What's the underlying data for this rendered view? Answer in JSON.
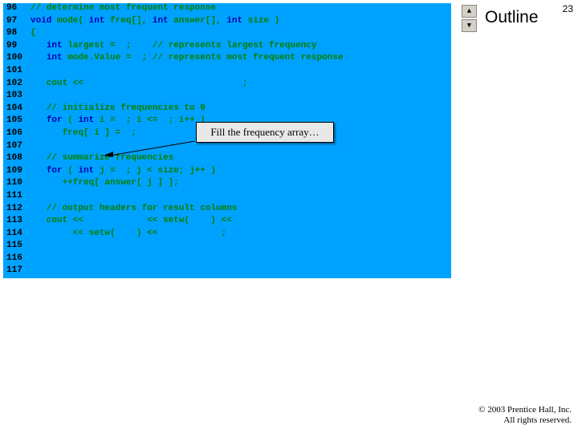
{
  "slide_number": "23",
  "outline_label": "Outline",
  "annotation": "Fill the frequency array…",
  "copyright_line1": "© 2003 Prentice Hall, Inc.",
  "copyright_line2": "All rights reserved.",
  "lines": [
    {
      "n": "96",
      "tokens": [
        {
          "t": "// determine most frequent response",
          "c": "cm"
        }
      ]
    },
    {
      "n": "97",
      "tokens": [
        {
          "t": "void",
          "c": "kw"
        },
        {
          "t": " mode( "
        },
        {
          "t": "int",
          "c": "kw"
        },
        {
          "t": " freq[], "
        },
        {
          "t": "int",
          "c": "kw"
        },
        {
          "t": " answer[], "
        },
        {
          "t": "int",
          "c": "kw"
        },
        {
          "t": " size )"
        }
      ]
    },
    {
      "n": "98",
      "tokens": [
        {
          "t": "{"
        }
      ]
    },
    {
      "n": "99",
      "tokens": [
        {
          "t": "   "
        },
        {
          "t": "int",
          "c": "kw"
        },
        {
          "t": " largest =  ;    "
        },
        {
          "t": "// represents largest frequency",
          "c": "cm"
        }
      ]
    },
    {
      "n": "100",
      "tokens": [
        {
          "t": "   "
        },
        {
          "t": "int",
          "c": "kw"
        },
        {
          "t": " mode.Value =  ; "
        },
        {
          "t": "// represents most frequent response",
          "c": "cm"
        }
      ]
    },
    {
      "n": "101",
      "tokens": []
    },
    {
      "n": "102",
      "tokens": [
        {
          "t": "   cout <<                              ;"
        }
      ]
    },
    {
      "n": "103",
      "tokens": []
    },
    {
      "n": "104",
      "tokens": [
        {
          "t": "   "
        },
        {
          "t": "// initialize frequencies to 0",
          "c": "cm"
        }
      ]
    },
    {
      "n": "105",
      "tokens": [
        {
          "t": "   "
        },
        {
          "t": "for",
          "c": "kw"
        },
        {
          "t": " ( "
        },
        {
          "t": "int",
          "c": "kw"
        },
        {
          "t": " i =  ; i <=  ; i++ )"
        }
      ]
    },
    {
      "n": "106",
      "tokens": [
        {
          "t": "      freq[ i ] =  ;"
        }
      ]
    },
    {
      "n": "107",
      "tokens": []
    },
    {
      "n": "108",
      "tokens": [
        {
          "t": "   "
        },
        {
          "t": "// summarize frequencies",
          "c": "cm"
        }
      ]
    },
    {
      "n": "109",
      "tokens": [
        {
          "t": "   "
        },
        {
          "t": "for",
          "c": "kw"
        },
        {
          "t": " ( "
        },
        {
          "t": "int",
          "c": "kw"
        },
        {
          "t": " j =  ; j < size; j++ )"
        }
      ]
    },
    {
      "n": "110",
      "tokens": [
        {
          "t": "      ++freq[ answer[ j ] ];"
        }
      ]
    },
    {
      "n": "111",
      "tokens": []
    },
    {
      "n": "112",
      "tokens": [
        {
          "t": "   "
        },
        {
          "t": "// output headers for result columns",
          "c": "cm"
        }
      ]
    },
    {
      "n": "113",
      "tokens": [
        {
          "t": "   cout <<            << setw(    ) <<"
        }
      ]
    },
    {
      "n": "114",
      "tokens": [
        {
          "t": "        << setw(    ) <<            ;"
        }
      ]
    },
    {
      "n": "115",
      "tokens": []
    },
    {
      "n": "116",
      "tokens": []
    },
    {
      "n": "117",
      "tokens": []
    }
  ]
}
